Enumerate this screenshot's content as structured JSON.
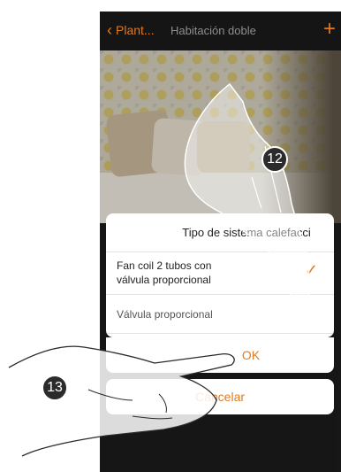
{
  "topbar": {
    "back_label": "Plant...",
    "title": "Habitación doble"
  },
  "dialog": {
    "title": "Tipo de sistema calefacci",
    "options": [
      {
        "label_line1": "Fan coil 2 tubos con",
        "label_line2": "válvula proporcional",
        "selected": true
      },
      {
        "label": "Válvula proporcional",
        "selected": false
      }
    ],
    "ok_label": "OK",
    "cancel_label": "Cancelar"
  },
  "callouts": {
    "step_12": "12",
    "step_13": "13"
  },
  "colors": {
    "accent": "#e07a20",
    "topbar": "#151515",
    "sheet": "#ffffff"
  },
  "icons": {
    "back": "chevron-left-icon",
    "add": "plus-icon",
    "selected": "checkmark-icon"
  }
}
